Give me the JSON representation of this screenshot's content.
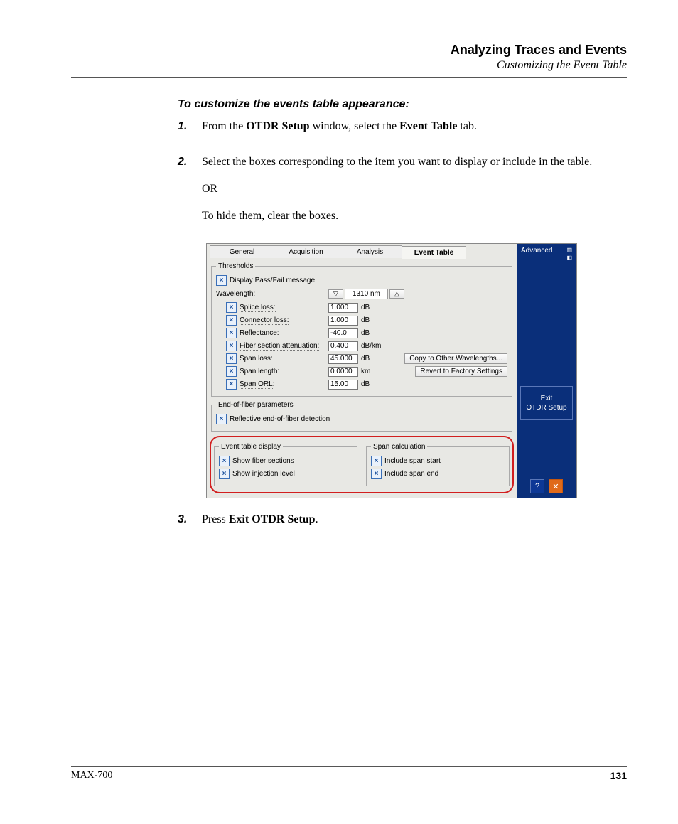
{
  "header": {
    "title": "Analyzing Traces and Events",
    "subtitle": "Customizing the Event Table"
  },
  "intro": "To customize the events table appearance:",
  "steps": {
    "s1": {
      "num": "1.",
      "pre": "From the ",
      "b1": "OTDR Setup",
      "mid": " window, select the ",
      "b2": "Event Table",
      "post": " tab."
    },
    "s2": {
      "num": "2.",
      "p1": "Select the boxes corresponding to the item you want to display or include in the table.",
      "p2": "OR",
      "p3": "To hide them, clear the boxes."
    },
    "s3": {
      "num": "3.",
      "pre": "Press ",
      "b1": "Exit OTDR Setup",
      "post": "."
    }
  },
  "dialog": {
    "tabs": {
      "general": "General",
      "acquisition": "Acquisition",
      "analysis": "Analysis",
      "event_table": "Event Table"
    },
    "sidebar": {
      "advanced": "Advanced",
      "exit1": "Exit",
      "exit2": "OTDR Setup"
    },
    "thresholds": {
      "legend": "Thresholds",
      "passfail": "Display Pass/Fail message",
      "wavelength_label": "Wavelength:",
      "wavelength_value": "1310 nm",
      "splice_label": "Splice loss:",
      "splice_val": "1.000",
      "splice_unit": "dB",
      "conn_label": "Connector loss:",
      "conn_val": "1.000",
      "conn_unit": "dB",
      "refl_label": "Reflectance:",
      "refl_val": "-40.0",
      "refl_unit": "dB",
      "fsa_label": "Fiber section attenuation:",
      "fsa_val": "0.400",
      "fsa_unit": "dB/km",
      "spanloss_label": "Span loss:",
      "spanloss_val": "45.000",
      "spanloss_unit": "dB",
      "spanlen_label": "Span length:",
      "spanlen_val": "0.0000",
      "spanlen_unit": "km",
      "spanorl_label": "Span ORL:",
      "spanorl_val": "15.00",
      "spanorl_unit": "dB",
      "copy_btn": "Copy to Other Wavelengths...",
      "revert_btn": "Revert to Factory Settings"
    },
    "eof": {
      "legend": "End-of-fiber parameters",
      "refl": "Reflective end-of-fiber detection"
    },
    "etd": {
      "legend": "Event table display",
      "fiber": "Show fiber sections",
      "inj": "Show injection level"
    },
    "span": {
      "legend": "Span calculation",
      "start": "Include span start",
      "end": "Include span end"
    }
  },
  "footer": {
    "product": "MAX-700",
    "page": "131"
  }
}
